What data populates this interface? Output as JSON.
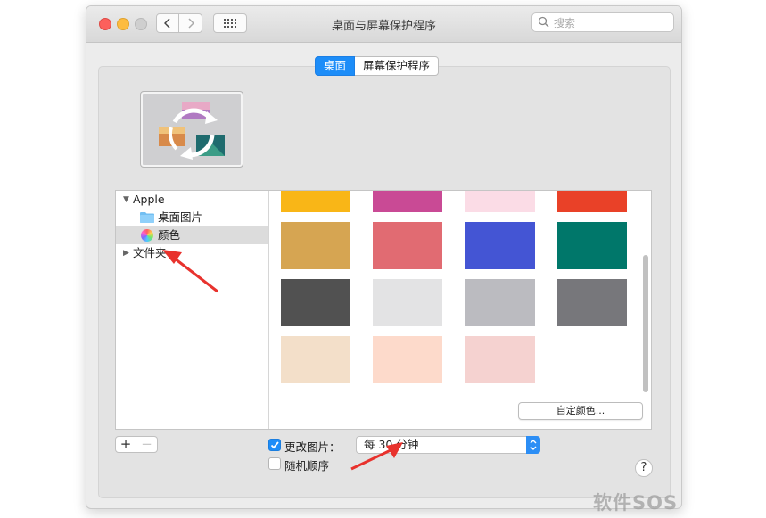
{
  "window": {
    "title": "桌面与屏幕保护程序",
    "search_placeholder": "搜索"
  },
  "tabs": [
    {
      "label": "桌面",
      "active": true
    },
    {
      "label": "屏幕保护程序",
      "active": false
    }
  ],
  "sidebar": {
    "groups": [
      {
        "label": "Apple",
        "expanded": true,
        "items": [
          {
            "label": "桌面图片",
            "icon": "folder-icon",
            "selected": false
          },
          {
            "label": "颜色",
            "icon": "color-wheel-icon",
            "selected": true
          }
        ]
      },
      {
        "label": "文件夹",
        "expanded": false,
        "items": []
      }
    ]
  },
  "colors": {
    "swatches": [
      "#f9b617",
      "#c94a95",
      "#fbdce6",
      "#e94128",
      "#d6a552",
      "#e16b72",
      "#4455d4",
      "#00776a",
      "#515151",
      "#e3e3e4",
      "#bbbbc0",
      "#77777b",
      "#f3dfc9",
      "#fddacb",
      "#f5d2d0"
    ],
    "customize_label": "自定颜色..."
  },
  "options": {
    "change_picture": {
      "label": "更改图片：",
      "checked": true
    },
    "interval": "每 30 分钟",
    "random_order": {
      "label": "随机顺序",
      "checked": false
    }
  },
  "controls": {
    "add_label": "+",
    "remove_label": "−",
    "help_label": "?"
  },
  "watermark": "软件SOS",
  "accent_color": "#1d8df8"
}
